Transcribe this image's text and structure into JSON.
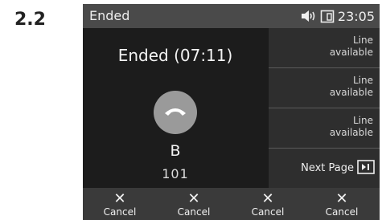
{
  "step_label": "2.2",
  "status_bar": {
    "title": "Ended",
    "time": "23:05",
    "icons": [
      "speaker-icon",
      "phone-screen-icon"
    ]
  },
  "call": {
    "status": "Ended",
    "duration": "(07:11)",
    "caller_name": "B",
    "caller_number": "101",
    "hangup_icon": "handset-down-icon"
  },
  "line_keys": [
    {
      "label_line1": "Line",
      "label_line2": "available"
    },
    {
      "label_line1": "Line",
      "label_line2": "available"
    },
    {
      "label_line1": "Line",
      "label_line2": "available"
    }
  ],
  "next_page": {
    "label": "Next Page",
    "icon": "next-page-icon"
  },
  "softkeys": [
    {
      "icon": "close-icon",
      "symbol": "✕",
      "label": "Cancel"
    },
    {
      "icon": "close-icon",
      "symbol": "✕",
      "label": "Cancel"
    },
    {
      "icon": "close-icon",
      "symbol": "✕",
      "label": "Cancel"
    },
    {
      "icon": "close-icon",
      "symbol": "✕",
      "label": "Cancel"
    }
  ],
  "colors": {
    "screen_bg": "#1a1a1a",
    "status_bar_bg": "#4a4a4a",
    "softkey_bar_bg": "#3a3a3a",
    "hangup_button": "#9a9a9a",
    "side_panel_bg": "#2e2e2e"
  }
}
